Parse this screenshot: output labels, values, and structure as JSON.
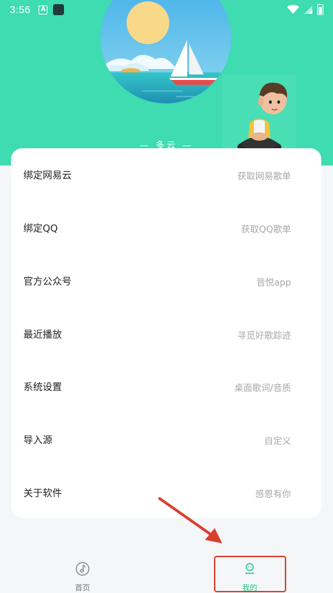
{
  "status_bar": {
    "time": "3:56",
    "badge_letter": "A",
    "icons": [
      "a-badge-icon",
      "app-square-icon",
      "wifi-icon",
      "signal-icon",
      "battery-icon"
    ]
  },
  "header": {
    "weather": "— 多云 —"
  },
  "menu": {
    "items": [
      {
        "label": "绑定网易云",
        "hint": "获取网易歌单"
      },
      {
        "label": "绑定QQ",
        "hint": "获取QQ歌单"
      },
      {
        "label": "官方公众号",
        "hint": "音悦app"
      },
      {
        "label": "最近播放",
        "hint": "寻觅好歌踪迹"
      },
      {
        "label": "系统设置",
        "hint": "桌面歌词/音质"
      },
      {
        "label": "导入源",
        "hint": "自定义"
      },
      {
        "label": "关于软件",
        "hint": "感恩有你"
      }
    ]
  },
  "bottom_nav": {
    "tabs": [
      {
        "label": "首页",
        "icon": "disc-icon",
        "active": false
      },
      {
        "label": "我的",
        "icon": "profile-icon",
        "active": true
      }
    ]
  },
  "colors": {
    "accent": "#3edcb0",
    "active_tab": "#2fc48e",
    "annotation": "#d9402d"
  }
}
